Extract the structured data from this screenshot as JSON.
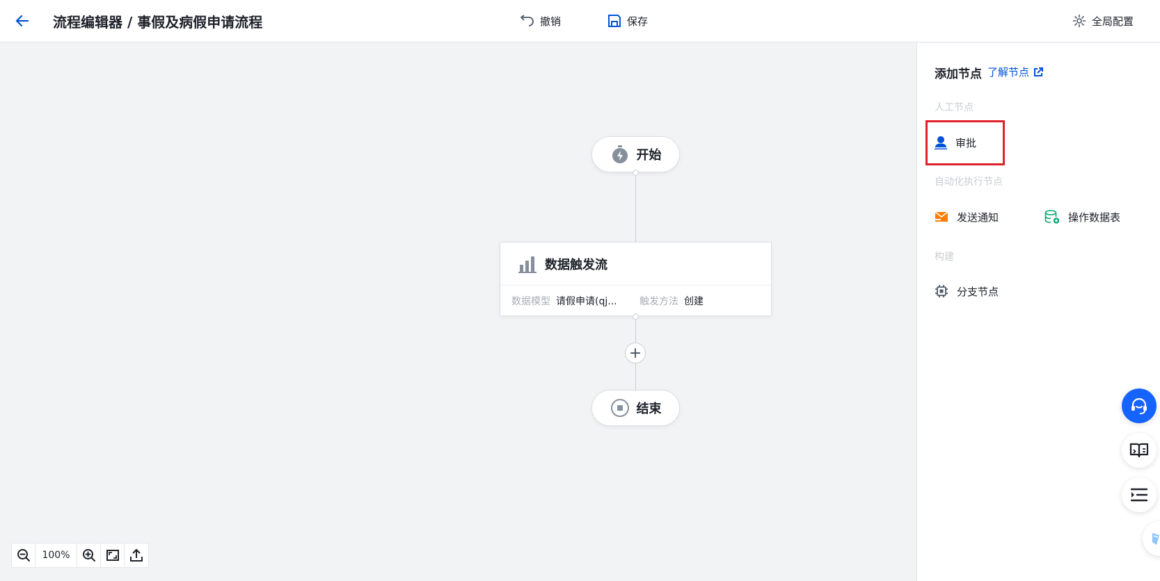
{
  "header": {
    "title": "流程编辑器 / 事假及病假申请流程",
    "undo_label": "撤销",
    "save_label": "保存",
    "config_label": "全局配置"
  },
  "canvas": {
    "start_label": "开始",
    "trigger": {
      "title": "数据触发流",
      "model_key": "数据模型",
      "model_value": "请假申请(qj...",
      "method_key": "触发方法",
      "method_value": "创建"
    },
    "end_label": "结束",
    "zoom": "100%"
  },
  "panel": {
    "title": "添加节点",
    "learn_link": "了解节点",
    "sections": [
      {
        "label": "人工节点",
        "items": [
          {
            "label": "审批",
            "icon": "user-icon"
          }
        ]
      },
      {
        "label": "自动化执行节点",
        "items": [
          {
            "label": "发送通知",
            "icon": "mail-icon"
          },
          {
            "label": "操作数据表",
            "icon": "database-add-icon"
          }
        ]
      },
      {
        "label": "构建",
        "items": [
          {
            "label": "分支节点",
            "icon": "branch-icon"
          }
        ]
      }
    ]
  },
  "colors": {
    "accent": "#0052d9",
    "highlight": "#e0202a",
    "notify": "#ff7d00",
    "database": "#00a870",
    "fab_primary": "#1664ff"
  }
}
